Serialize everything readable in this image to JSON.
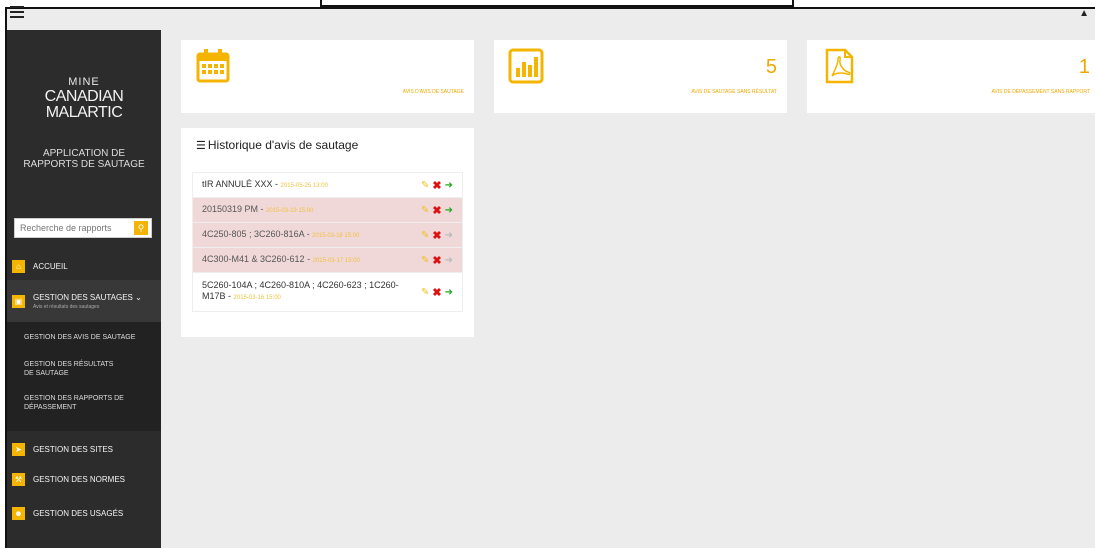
{
  "app": {
    "logo": {
      "line1": "MINE",
      "line2": "CANADIAN",
      "line3": "MALARTIC"
    },
    "title_line1": "APPLICATION DE",
    "title_line2": "RAPPORTS DE SAUTAGE"
  },
  "search": {
    "placeholder": "Recherche de rapports"
  },
  "nav": {
    "accueil": "ACCUEIL",
    "gestion_sautages": "GESTION DES SAUTAGES",
    "gestion_sautages_sub": "Avis et résultats des sautages",
    "subitems": [
      "GESTION DES AVIS DE SAUTAGE",
      "GESTION DES RÉSULTATS DE SAUTAGE",
      "GESTION DES RAPPORTS DE DÉPASSEMENT"
    ],
    "sites": "GESTION DES SITES",
    "normes": "GESTION DES NORMES",
    "usages": "GESTION DES USAGÉS"
  },
  "stats": [
    {
      "value": "",
      "label": "AVIS D'AVIS DE SAUTAGE",
      "icon": "calendar-icon"
    },
    {
      "value": "5",
      "label": "AVIS DE SAUTAGE SANS RÉSULTAT",
      "icon": "bar-chart-icon"
    },
    {
      "value": "1",
      "label": "AVIS DE DÉPASSEMENT SANS RAPPORT",
      "icon": "pdf-icon"
    }
  ],
  "history": {
    "title": "Historique d'avis de sautage",
    "rows": [
      {
        "text": "tIR ANNULÉ XXX - ",
        "date": "2015-05-25 13:00",
        "highlight": false
      },
      {
        "text": "20150319 PM - ",
        "date": "2015-03-19 15:00",
        "highlight": true
      },
      {
        "text": "4C250-805 ; 3C260-816A - ",
        "date": "2015-03-18 15:00",
        "highlight": true
      },
      {
        "text": "4C300-M41 & 3C260-612 - ",
        "date": "2015-03-17 15:00",
        "highlight": true
      },
      {
        "text": "5C260-104A ; 4C260-810A ; 4C260-623 ; 1C260-M17B - ",
        "date": "2015-03-16 15:00",
        "highlight": false
      }
    ]
  },
  "colors": {
    "accent": "#f4b400",
    "sidebar": "#2c2c2c",
    "highlight_row": "#f1d8d8"
  }
}
